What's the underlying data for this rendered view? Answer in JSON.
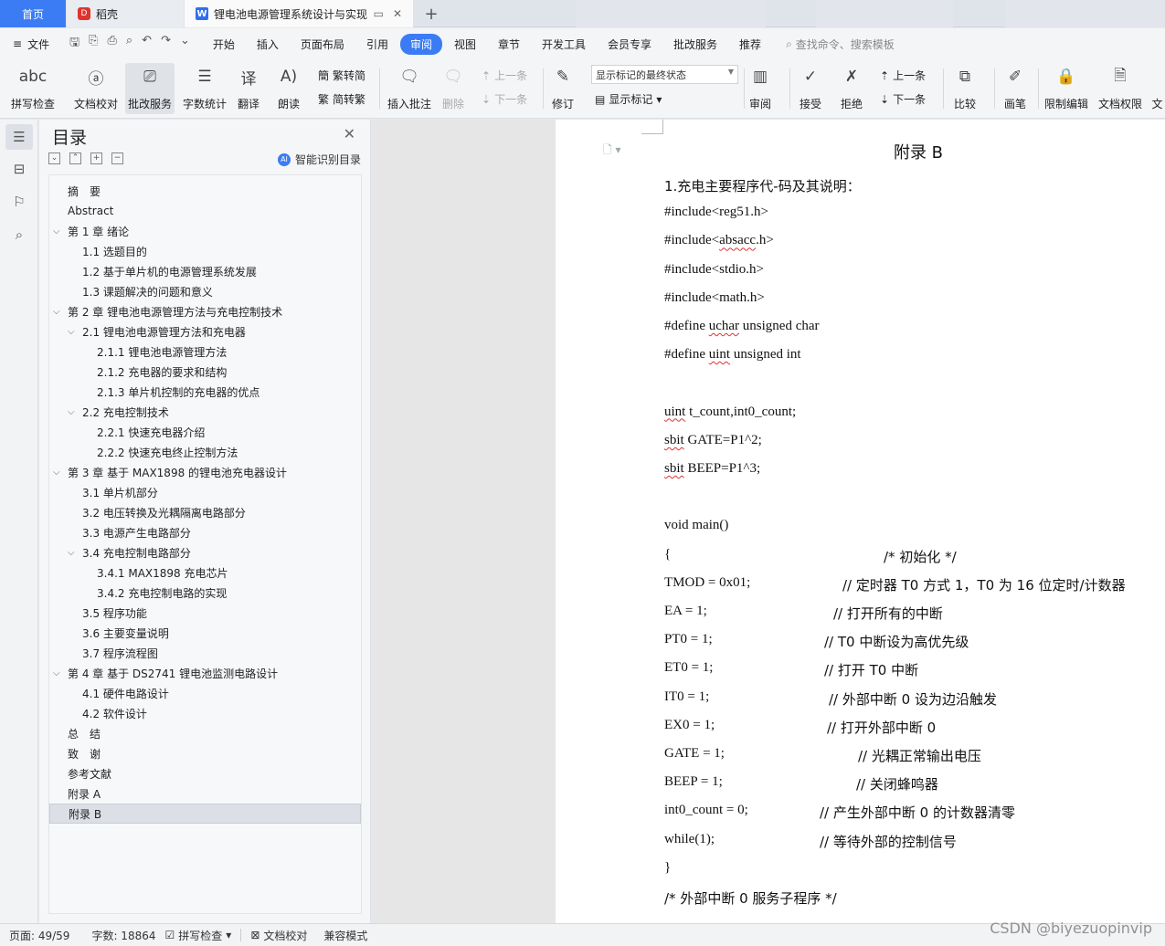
{
  "tabs": {
    "home": "首页",
    "daoke": "稻壳",
    "doc": "锂电池电源管理系统设计与实现",
    "add": "+"
  },
  "menu": {
    "file": "文件",
    "items": [
      "开始",
      "插入",
      "页面布局",
      "引用",
      "审阅",
      "视图",
      "章节",
      "开发工具",
      "会员专享",
      "批改服务",
      "推荐"
    ],
    "active": "审阅",
    "search": "查找命令、搜索模板"
  },
  "ribbon": {
    "spell": "拼写检查",
    "proofread": "文档校对",
    "review_service": "批改服务",
    "word_count": "字数统计",
    "translate": "翻译",
    "read_aloud": "朗读",
    "trad_to_simp": "繁转简",
    "simp_to_trad": "简转繁",
    "insert_comment": "插入批注",
    "delete": "删除",
    "prev": "上一条",
    "next": "下一条",
    "revise": "修订",
    "markup_select": "显示标记的最终状态",
    "show_markup": "显示标记",
    "review": "审阅",
    "accept": "接受",
    "reject": "拒绝",
    "prev2": "上一条",
    "next2": "下一条",
    "compare": "比较",
    "pen": "画笔",
    "restrict": "限制编辑",
    "permission": "文档权限",
    "cut_label": "文"
  },
  "toc": {
    "title": "目录",
    "ai": "智能识别目录",
    "items": [
      {
        "text": "摘　要",
        "level": 1,
        "chev": ""
      },
      {
        "text": "Abstract",
        "level": 1,
        "chev": ""
      },
      {
        "text": "第 1 章  绪论",
        "level": 1,
        "chev": "v"
      },
      {
        "text": "1.1  选题目的",
        "level": 2,
        "chev": ""
      },
      {
        "text": "1.2  基于单片机的电源管理系统发展",
        "level": 2,
        "chev": ""
      },
      {
        "text": "1.3  课题解决的问题和意义",
        "level": 2,
        "chev": ""
      },
      {
        "text": "第 2 章  锂电池电源管理方法与充电控制技术",
        "level": 1,
        "chev": "v"
      },
      {
        "text": "2.1  锂电池电源管理方法和充电器",
        "level": 2,
        "chev": "v"
      },
      {
        "text": "2.1.1 锂电池电源管理方法",
        "level": 3,
        "chev": ""
      },
      {
        "text": "2.1.2 充电器的要求和结构",
        "level": 3,
        "chev": ""
      },
      {
        "text": "2.1.3 单片机控制的充电器的优点",
        "level": 3,
        "chev": ""
      },
      {
        "text": "2.2  充电控制技术",
        "level": 2,
        "chev": "v"
      },
      {
        "text": "2.2.1  快速充电器介绍",
        "level": 3,
        "chev": ""
      },
      {
        "text": "2.2.2  快速充电终止控制方法",
        "level": 3,
        "chev": ""
      },
      {
        "text": " 第 3 章  基于 MAX1898 的锂电池充电器设计",
        "level": 1,
        "chev": "v"
      },
      {
        "text": "3.1  单片机部分",
        "level": 2,
        "chev": ""
      },
      {
        "text": "3.2  电压转换及光耦隔离电路部分",
        "level": 2,
        "chev": ""
      },
      {
        "text": "3.3  电源产生电路部分",
        "level": 2,
        "chev": ""
      },
      {
        "text": "3.4  充电控制电路部分",
        "level": 2,
        "chev": "v"
      },
      {
        "text": "3.4.1 MAX1898 充电芯片",
        "level": 3,
        "chev": ""
      },
      {
        "text": "3.4.2 充电控制电路的实现",
        "level": 3,
        "chev": ""
      },
      {
        "text": "3.5  程序功能",
        "level": 2,
        "chev": ""
      },
      {
        "text": "3.6  主要变量说明",
        "level": 2,
        "chev": ""
      },
      {
        "text": "3.7  程序流程图",
        "level": 2,
        "chev": ""
      },
      {
        "text": "第 4 章  基于 DS2741 锂电池监测电路设计",
        "level": 1,
        "chev": "v"
      },
      {
        "text": "4.1  硬件电路设计",
        "level": 2,
        "chev": ""
      },
      {
        "text": "4.2  软件设计",
        "level": 2,
        "chev": ""
      },
      {
        "text": "总　结",
        "level": 1,
        "chev": ""
      },
      {
        "text": "致　谢",
        "level": 1,
        "chev": ""
      },
      {
        "text": "参考文献",
        "level": 1,
        "chev": ""
      },
      {
        "text": "附录 A",
        "level": 1,
        "chev": ""
      },
      {
        "text": "附录 B",
        "level": 1,
        "chev": "",
        "selected": true
      }
    ]
  },
  "doc": {
    "title": "附录 B",
    "lines": [
      {
        "code": "1.充电主要程序代-码及其说明：",
        "comment": ""
      },
      {
        "code": "#include<reg51.h>",
        "comment": ""
      },
      {
        "code": "#include<absacc.h>",
        "comment": ""
      },
      {
        "code": "#include<stdio.h>",
        "comment": ""
      },
      {
        "code": "#include<math.h>",
        "comment": ""
      },
      {
        "code": "#define uchar unsigned char",
        "comment": ""
      },
      {
        "code": "#define uint unsigned int",
        "comment": ""
      },
      {
        "code": "",
        "comment": ""
      },
      {
        "code": "uint t_count,int0_count;",
        "comment": ""
      },
      {
        "code": "sbit GATE=P1^2;",
        "comment": ""
      },
      {
        "code": "sbit BEEP=P1^3;",
        "comment": ""
      },
      {
        "code": "",
        "comment": ""
      },
      {
        "code": "void main()",
        "comment": ""
      },
      {
        "code": "{",
        "comment": "/*  初始化  */"
      },
      {
        "code": "TMOD = 0x01;",
        "comment": "//  定时器 T0 方式 1，T0 为 16 位定时/计数器"
      },
      {
        "code": "EA = 1;",
        "comment": "//  打开所有的中断"
      },
      {
        "code": "PT0 = 1;",
        "comment": "// T0 中断设为高优先级"
      },
      {
        "code": "ET0 = 1;",
        "comment": "//  打开 T0 中断"
      },
      {
        "code": "IT0 = 1;",
        "comment": "//  外部中断 0 设为边沿触发"
      },
      {
        "code": "EX0 = 1;",
        "comment": "//  打开外部中断 0"
      },
      {
        "code": "GATE = 1;",
        "comment": "//  光耦正常输出电压"
      },
      {
        "code": "BEEP = 1;",
        "comment": "//  关闭蜂鸣器"
      },
      {
        "code": "int0_count = 0;",
        "comment": "//  产生外部中断 0 的计数器清零"
      },
      {
        "code": "while(1);",
        "comment": "//  等待外部的控制信号"
      },
      {
        "code": "}",
        "comment": ""
      },
      {
        "code": "/*  外部中断 0 服务子程序  */",
        "comment": ""
      }
    ]
  },
  "status": {
    "page": "页面: 49/59",
    "words": "字数: 18864",
    "spell": "拼写检查",
    "proof": "文档校对",
    "compat": "兼容模式"
  },
  "watermark": "CSDN @biyezuopinvip",
  "colors": {
    "accent": "#3b7cf5",
    "squiggle": "#dd3333"
  }
}
